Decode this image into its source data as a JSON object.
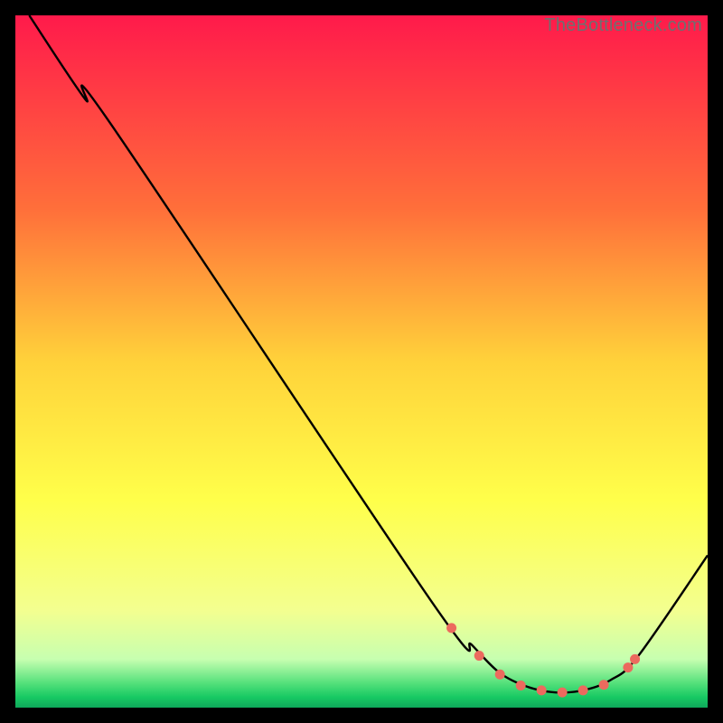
{
  "watermark": "TheBottleneck.com",
  "chart_data": {
    "type": "line",
    "title": "",
    "xlabel": "",
    "ylabel": "",
    "xlim": [
      0,
      100
    ],
    "ylim": [
      0,
      100
    ],
    "gradient_stops": [
      {
        "offset": 0,
        "color": "#ff1a4b"
      },
      {
        "offset": 0.28,
        "color": "#ff6f3a"
      },
      {
        "offset": 0.5,
        "color": "#ffd23a"
      },
      {
        "offset": 0.7,
        "color": "#ffff4a"
      },
      {
        "offset": 0.86,
        "color": "#f3ff90"
      },
      {
        "offset": 0.93,
        "color": "#c7ffb0"
      },
      {
        "offset": 0.965,
        "color": "#53e07a"
      },
      {
        "offset": 0.985,
        "color": "#17c963"
      },
      {
        "offset": 1.0,
        "color": "#0fa85b"
      }
    ],
    "series": [
      {
        "name": "bottleneck-curve",
        "x": [
          2,
          10,
          14,
          60,
          66,
          70,
          74,
          78,
          82,
          86,
          90,
          100
        ],
        "y": [
          100,
          88,
          84,
          15.5,
          9,
          5,
          3,
          2.2,
          2.5,
          4,
          7.5,
          22
        ]
      }
    ],
    "markers": {
      "name": "highlight-dots",
      "color": "#ec6a5e",
      "x": [
        63,
        67,
        70,
        73,
        76,
        79,
        82,
        85,
        88.5,
        89.5
      ],
      "y": [
        11.5,
        7.5,
        4.8,
        3.2,
        2.5,
        2.2,
        2.5,
        3.3,
        5.8,
        7.0
      ]
    }
  }
}
